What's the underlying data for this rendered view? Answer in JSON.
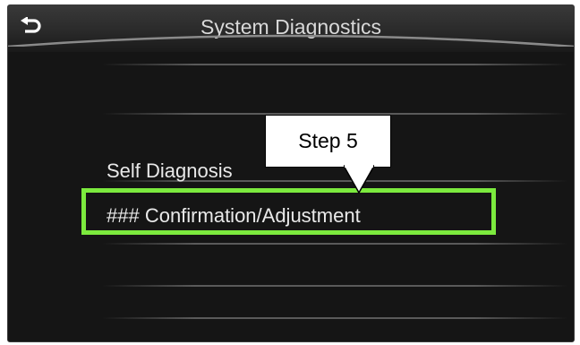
{
  "header": {
    "title": "System Diagnostics",
    "back_icon": "back-arrow-icon"
  },
  "menu": {
    "items": [
      {
        "label": "Self Diagnosis"
      },
      {
        "label": "### Confirmation/Adjustment",
        "highlighted": true
      }
    ]
  },
  "annotation": {
    "label": "Step 5",
    "highlight_color": "#7cea3e"
  }
}
